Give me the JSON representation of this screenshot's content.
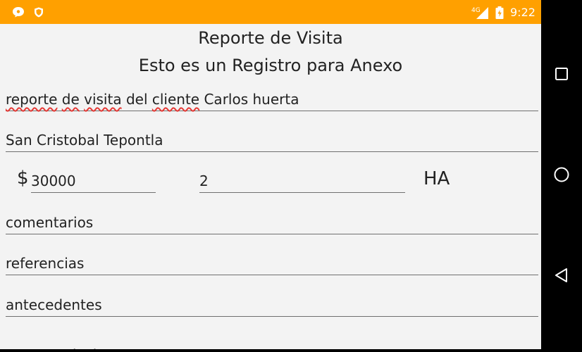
{
  "status_bar": {
    "time": "9:22",
    "network": "4G",
    "icons": [
      "chat-notification-icon",
      "shield-icon",
      "signal-icon",
      "battery-icon"
    ],
    "background_color": "#ffa000"
  },
  "header": {
    "title": "Reporte de Visita",
    "subtitle": "Esto es un Registro para Anexo"
  },
  "form": {
    "reporte": {
      "words": [
        "reporte",
        "de",
        "visita",
        "del",
        "cliente",
        "Carlos huerta"
      ]
    },
    "direccion": "San Cristobal Tepontla",
    "currency_symbol": "$",
    "monto": "30000",
    "hectareas": "2",
    "hectareas_unit": "HA",
    "comentarios": "comentarios",
    "referencias": "referencias",
    "antecedentes": "antecedentes",
    "recomendacion": "recomendacion"
  },
  "nav_bar": {
    "buttons": [
      "recents-icon",
      "home-icon",
      "back-icon"
    ]
  }
}
